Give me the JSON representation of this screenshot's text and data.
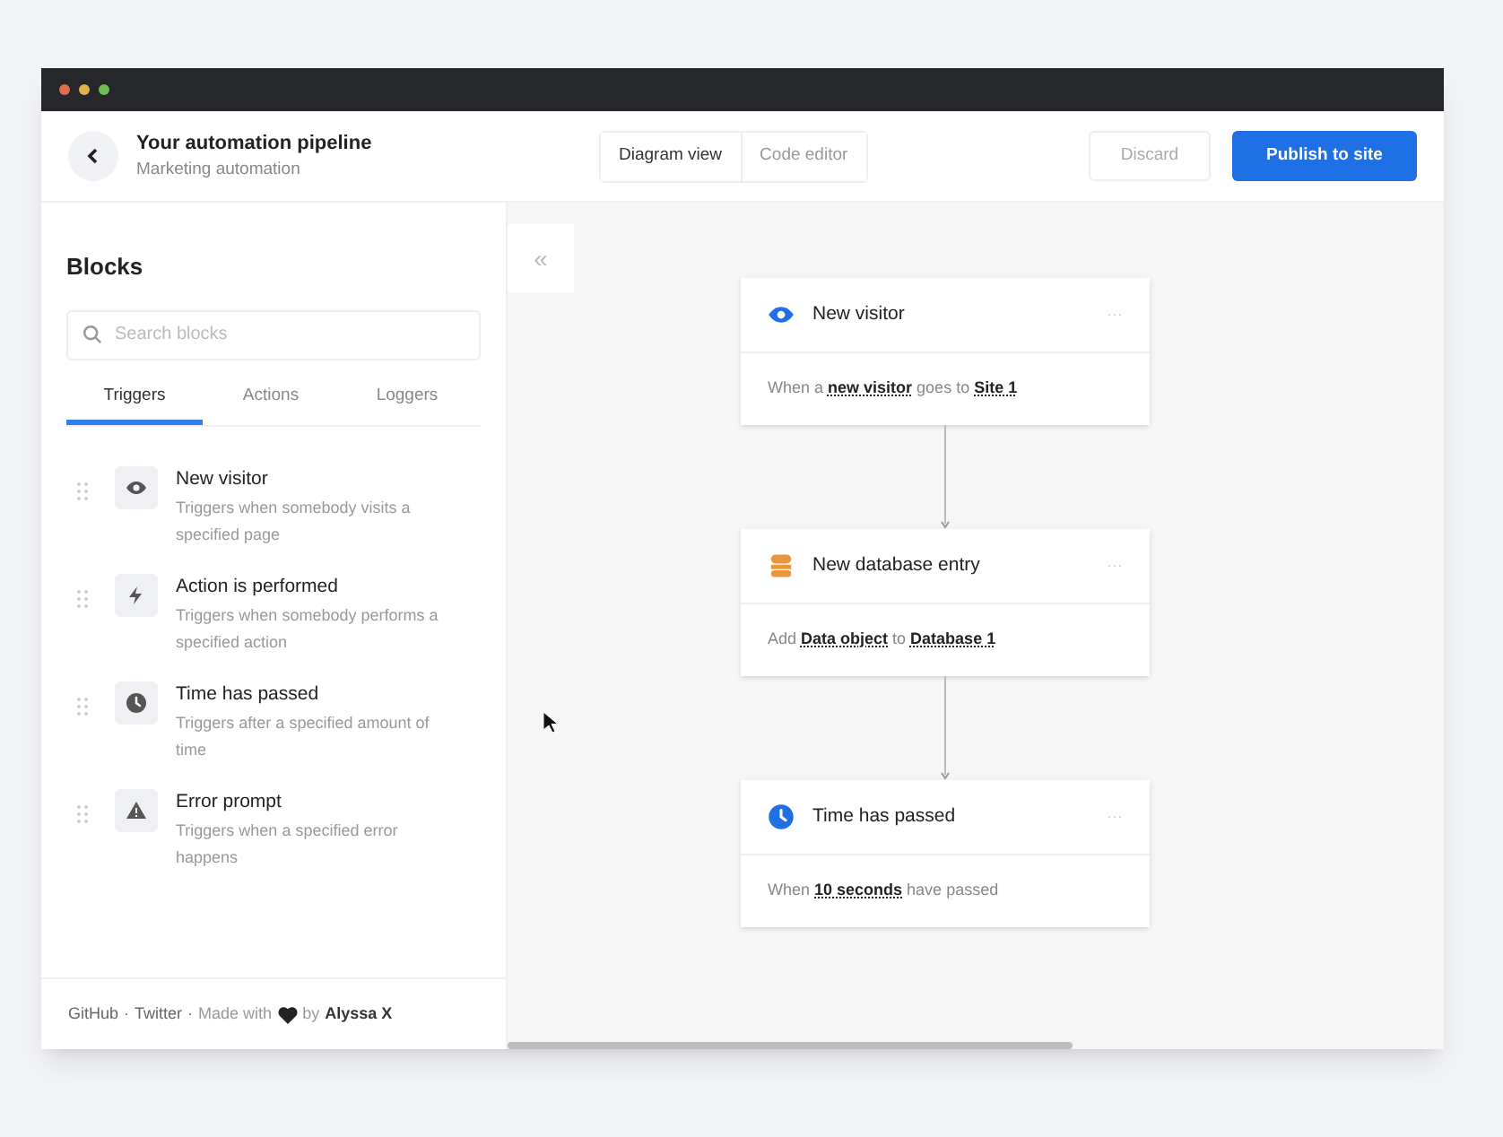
{
  "header": {
    "title": "Your automation pipeline",
    "subtitle": "Marketing automation",
    "views": [
      {
        "label": "Diagram view",
        "selected": true
      },
      {
        "label": "Code editor",
        "selected": false
      }
    ],
    "buttons": [
      {
        "label": "Discard",
        "kind": "secondary"
      },
      {
        "label": "Publish to site",
        "kind": "primary"
      }
    ]
  },
  "sidebar": {
    "title": "Blocks",
    "search": {
      "placeholder": "Search blocks"
    },
    "tabs": [
      {
        "label": "Triggers",
        "selected": true
      },
      {
        "label": "Actions",
        "selected": false
      },
      {
        "label": "Loggers",
        "selected": false
      }
    ],
    "items": [
      {
        "title": "New visitor",
        "description": "Triggers when somebody visits a specified page"
      },
      {
        "title": "Action is performed",
        "description": "Triggers when somebody performs a specified action"
      },
      {
        "title": "Time has passed",
        "description": "Triggers after a specified amount of time"
      },
      {
        "title": "Error prompt",
        "description": "Triggers when a specified error happens"
      }
    ],
    "footer": {
      "links": [
        "GitHub",
        "Twitter"
      ],
      "separator": "·",
      "made_with": "Made with",
      "by": "by",
      "author": "Alyssa X"
    }
  },
  "canvas": {
    "collapse_label": "«",
    "nodes": [
      {
        "title": "New visitor",
        "menu": "···",
        "description": "When a **new visitor** goes to **Site 1**"
      },
      {
        "title": "New database entry",
        "menu": "···",
        "description": "Add **Data object** to **Database 1**"
      },
      {
        "title": "Time has passed",
        "menu": "···",
        "description": "When **10 seconds** have passed"
      }
    ]
  }
}
